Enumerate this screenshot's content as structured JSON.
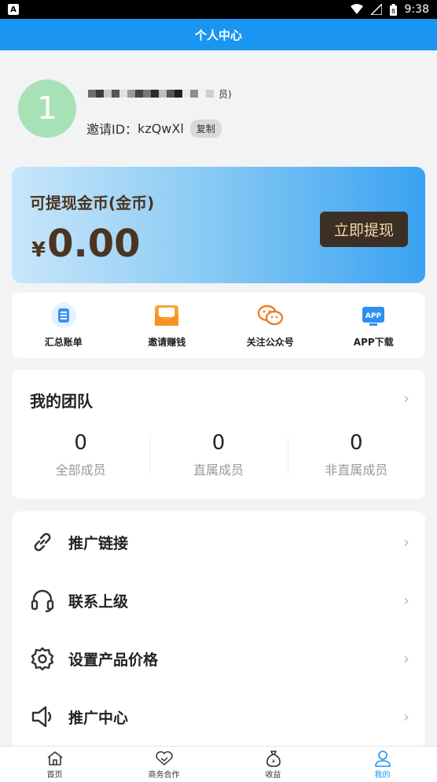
{
  "status_bar": {
    "app_badge": "A",
    "time": "9:38",
    "battery_level": "8"
  },
  "header": {
    "title": "个人中心"
  },
  "profile": {
    "avatar_text": "1",
    "member_tag": "员)",
    "invite_label": "邀请ID：",
    "invite_id": "kzQwXl",
    "copy_label": "复制"
  },
  "balance": {
    "title": "可提现金币(金币)",
    "currency": "¥",
    "amount": "0.00",
    "withdraw_label": "立即提现"
  },
  "shortcuts": [
    {
      "label": "汇总账单",
      "icon": "bill-icon"
    },
    {
      "label": "邀请赚钱",
      "icon": "invite-envelope-icon"
    },
    {
      "label": "关注公众号",
      "icon": "wechat-icon"
    },
    {
      "label": "APP下载",
      "icon": "app-download-icon",
      "icon_text": "APP"
    }
  ],
  "team": {
    "title": "我的团队",
    "stats": [
      {
        "value": "0",
        "label": "全部成员"
      },
      {
        "value": "0",
        "label": "直属成员"
      },
      {
        "value": "0",
        "label": "非直属成员"
      }
    ]
  },
  "menu": [
    {
      "label": "推广链接",
      "icon": "link-icon"
    },
    {
      "label": "联系上级",
      "icon": "headset-icon"
    },
    {
      "label": "设置产品价格",
      "icon": "gear-icon"
    },
    {
      "label": "推广中心",
      "icon": "speaker-icon"
    }
  ],
  "tabbar": [
    {
      "label": "首页",
      "icon": "home-icon"
    },
    {
      "label": "商务合作",
      "icon": "handshake-icon"
    },
    {
      "label": "收益",
      "icon": "money-bag-icon",
      "icon_text": "¥"
    },
    {
      "label": "我的",
      "icon": "user-icon",
      "active": true
    }
  ],
  "colors": {
    "primary": "#1a95f0",
    "withdraw_button": "#3b2f26",
    "gold_text": "#4a3520",
    "avatar": "#a6e2b5"
  }
}
